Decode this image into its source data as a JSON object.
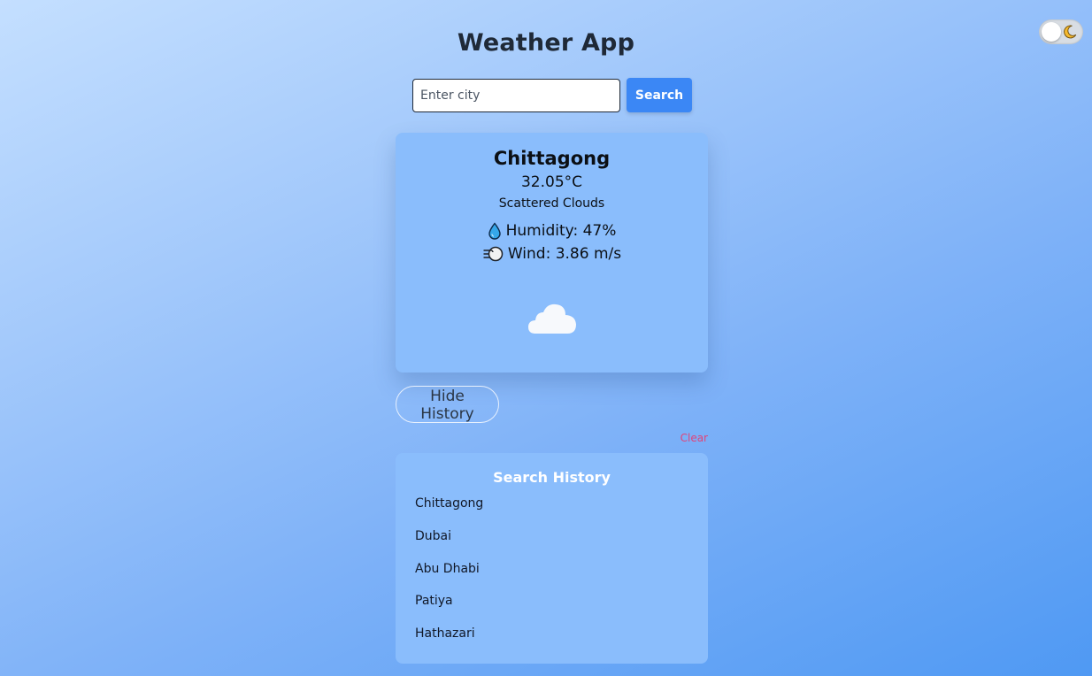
{
  "app": {
    "title": "Weather App"
  },
  "theme_toggle": {
    "icon": "moon-icon",
    "state": "light"
  },
  "search": {
    "placeholder": "Enter city",
    "value": "",
    "button_label": "Search"
  },
  "weather": {
    "city": "Chittagong",
    "temperature": "32.05°C",
    "description": "Scattered Clouds",
    "humidity": "Humidity: 47%",
    "wind": "Wind: 3.86 m/s",
    "condition_icon": "cloud-icon"
  },
  "history": {
    "toggle_label": "Hide History",
    "clear_label": "Clear",
    "title": "Search History",
    "items": [
      "Chittagong",
      "Dubai",
      "Abu Dhabi",
      "Patiya",
      "Hathazari"
    ]
  },
  "colors": {
    "accent": "#3b87f5",
    "card": "#8abdfc",
    "clear": "#e0437a"
  }
}
